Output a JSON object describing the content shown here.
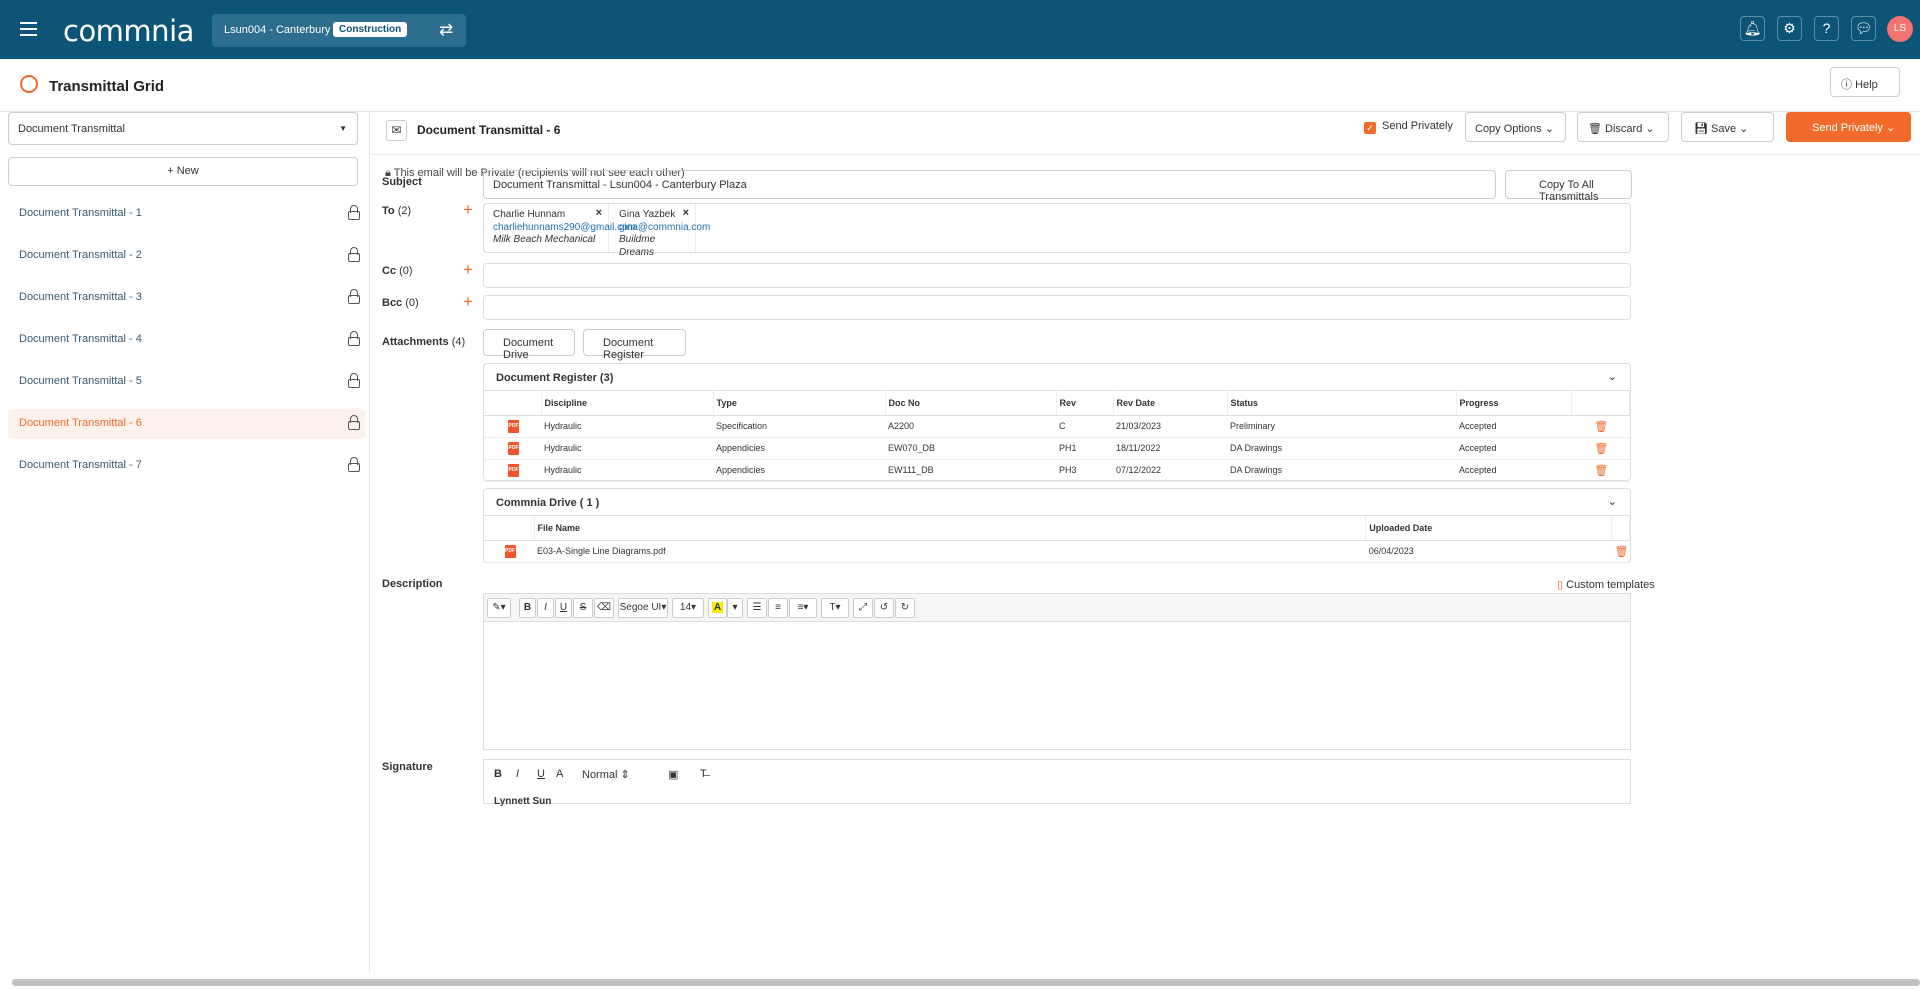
{
  "header": {
    "logo": "commnia",
    "project": "Lsun004 - Canterbury Plaza",
    "project_badge": "Construction",
    "avatar_initials": "LS"
  },
  "page": {
    "title": "Transmittal Grid",
    "help_label": "Help"
  },
  "sidebar": {
    "type_select": "Document Transmittal",
    "new_label": "+ New",
    "items": [
      {
        "label": "Document Transmittal - 1"
      },
      {
        "label": "Document Transmittal - 2"
      },
      {
        "label": "Document Transmittal - 3"
      },
      {
        "label": "Document Transmittal - 4"
      },
      {
        "label": "Document Transmittal - 5"
      },
      {
        "label": "Document Transmittal - 6",
        "active": true
      },
      {
        "label": "Document Transmittal - 7"
      }
    ]
  },
  "transmittal": {
    "title": "Document Transmittal - 6",
    "send_privately_checkbox": "Send Privately",
    "copy_options": "Copy Options",
    "discard": "Discard",
    "save": "Save",
    "send_button": "Send Privately",
    "private_note": "This email will be Private (recipients will not see each other)",
    "subject_label": "Subject",
    "subject_value": "Document Transmittal - Lsun004 - Canterbury Plaza",
    "copy_all": "Copy To All Transmittals",
    "to_label": "To",
    "to_count": "(2)",
    "cc_label": "Cc",
    "cc_count": "(0)",
    "bcc_label": "Bcc",
    "bcc_count": "(0)",
    "recipients": [
      {
        "name": "Charlie Hunnam",
        "email": "charliehunnams290@gmail.com",
        "company": "Milk Beach Mechanical"
      },
      {
        "name": "Gina Yazbek",
        "email": "gina@commnia.com",
        "company": "Buildme Dreams"
      }
    ],
    "attachments_label": "Attachments",
    "attachments_count": "(4)",
    "btn_drive": "Document Drive",
    "btn_register": "Document Register",
    "register": {
      "title": "Document Register (3)",
      "columns": [
        "Discipline",
        "Type",
        "Doc No",
        "Rev",
        "Rev Date",
        "Status",
        "Progress"
      ],
      "rows": [
        [
          "Hydraulic",
          "Specification",
          "A2200",
          "C",
          "21/03/2023",
          "Preliminary",
          "Accepted"
        ],
        [
          "Hydraulic",
          "Appendicies",
          "EW070_DB",
          "PH1",
          "18/11/2022",
          "DA Drawings",
          "Accepted"
        ],
        [
          "Hydraulic",
          "Appendicies",
          "EW111_DB",
          "PH3",
          "07/12/2022",
          "DA Drawings",
          "Accepted"
        ]
      ]
    },
    "drive": {
      "title": "Commnia Drive ( 1 )",
      "columns": [
        "File Name",
        "Uploaded Date"
      ],
      "rows": [
        [
          "E03-A-Single Line Diagrams.pdf",
          "06/04/2023"
        ]
      ]
    },
    "description_label": "Description",
    "custom_templates": "Custom templates",
    "editor": {
      "font": "Segoe UI",
      "size": "14"
    },
    "signature_label": "Signature",
    "signature_format": "Normal",
    "signature_text": "Lynnett Sun"
  }
}
